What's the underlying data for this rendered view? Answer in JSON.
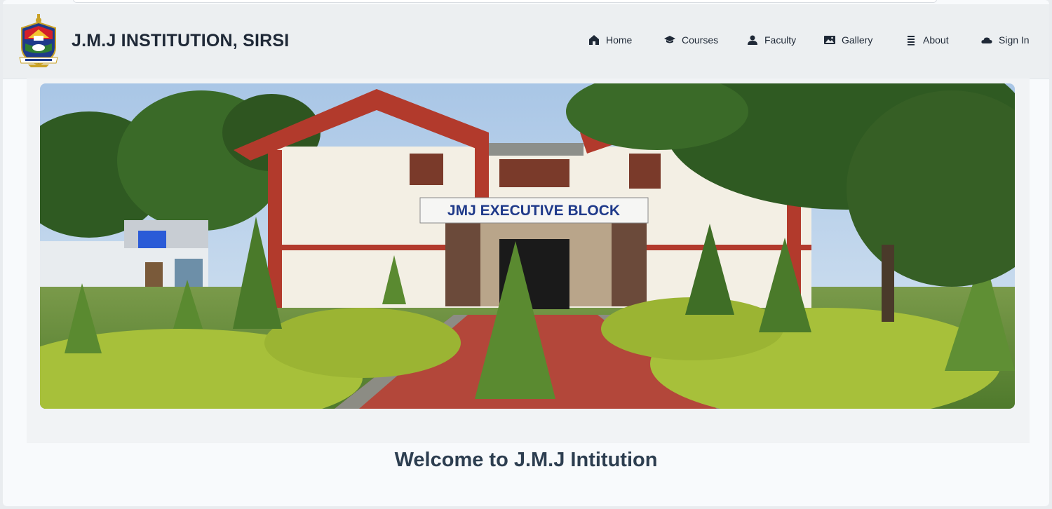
{
  "brand": {
    "title": "J.M.J INSTITUTION, SIRSI"
  },
  "nav": [
    {
      "label": "Home",
      "icon": "home-icon"
    },
    {
      "label": "Courses",
      "icon": "graduation-cap-icon"
    },
    {
      "label": "Faculty",
      "icon": "user-icon"
    },
    {
      "label": "Gallery",
      "icon": "image-icon"
    },
    {
      "label": "About",
      "icon": "list-icon"
    },
    {
      "label": "Sign In",
      "icon": "cloud-icon"
    }
  ],
  "hero": {
    "sign_text": "JMJ EXECUTIVE BLOCK"
  },
  "welcome": {
    "heading": "Welcome to J.M.J Intitution"
  },
  "colors": {
    "text": "#1f2937",
    "heading": "#2d3e50",
    "navbar": "#eceff1"
  }
}
